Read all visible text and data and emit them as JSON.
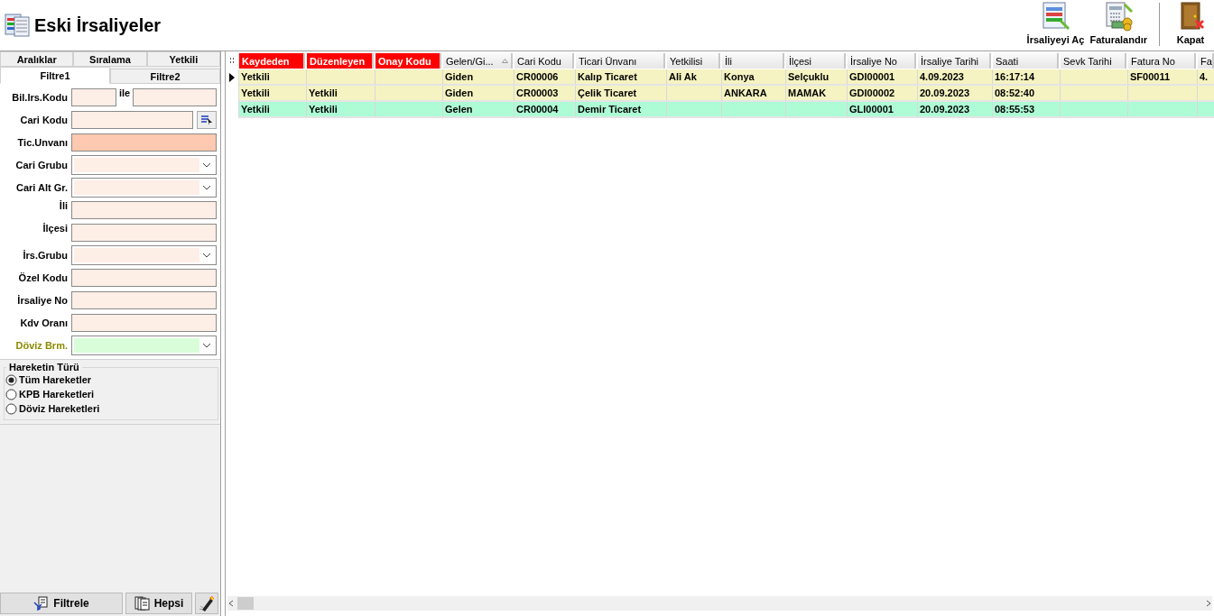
{
  "window": {
    "title": "Eski İrsaliyeler"
  },
  "toolbar": [
    {
      "label": "İrsaliyeyi Aç",
      "kind": "open"
    },
    {
      "label": "Faturalandır",
      "kind": "invoice"
    },
    {
      "label": "Kapat",
      "kind": "close"
    }
  ],
  "filter_tabs": {
    "top_row": [
      {
        "label": "Aralıklar",
        "selected": false
      },
      {
        "label": "Sıralama",
        "selected": false
      },
      {
        "label": "Yetkili",
        "selected": false
      }
    ],
    "bottom_row": [
      {
        "label": "Filtre1",
        "selected": true
      },
      {
        "label": "Filtre2",
        "selected": false
      }
    ]
  },
  "filters": [
    {
      "label": "Bil.Irs.Kodu",
      "kind": "range",
      "joiner": "ile",
      "color": "#fdeee6",
      "emphasized": false
    },
    {
      "label": "Cari Kodu",
      "kind": "lookup",
      "color": "#fdeee6",
      "emphasized": false
    },
    {
      "label": "Tic.Unvanı",
      "kind": "text",
      "color": "#fdc9b0",
      "emphasized": false
    },
    {
      "label": "Cari Grubu",
      "kind": "combo",
      "color": "#fdeee6",
      "emphasized": false
    },
    {
      "label": "Cari Alt Gr.",
      "kind": "combo",
      "color": "#fdeee6",
      "emphasized": false
    },
    {
      "label": "İli",
      "kind": "text",
      "color": "#fdeee6",
      "emphasized": false
    },
    {
      "label": "İlçesi",
      "kind": "text",
      "color": "#fdeee6",
      "emphasized": false
    },
    {
      "label": "İrs.Grubu",
      "kind": "combo",
      "color": "#fdeee6",
      "emphasized": false
    },
    {
      "label": "Özel Kodu",
      "kind": "text",
      "color": "#fdeee6",
      "emphasized": false
    },
    {
      "label": "İrsaliye No",
      "kind": "text",
      "color": "#fdeee6",
      "emphasized": false
    },
    {
      "label": "Kdv Oranı",
      "kind": "text",
      "color": "#fdeee6",
      "emphasized": false
    },
    {
      "label": "Döviz Brm.",
      "kind": "combo",
      "color": "#d8fdd8",
      "emphasized": true
    }
  ],
  "movement_type": {
    "title": "Hareketin Türü",
    "options": [
      {
        "label": "Tüm Hareketler",
        "selected": true
      },
      {
        "label": "KPB Hareketleri",
        "selected": false
      },
      {
        "label": "Döviz Hareketleri",
        "selected": false
      }
    ]
  },
  "filter_buttons": [
    {
      "label": "Filtrele",
      "kind": "filter"
    },
    {
      "label": "Hepsi",
      "kind": "all"
    },
    {
      "kind": "clear"
    }
  ],
  "table": {
    "columns": [
      {
        "label": "Kaydeden",
        "highlighted": true,
        "sorted": false
      },
      {
        "label": "Düzenleyen",
        "highlighted": true,
        "sorted": false
      },
      {
        "label": "Onay Kodu",
        "highlighted": true,
        "sorted": false
      },
      {
        "label": "Gelen/Gi...",
        "highlighted": false,
        "sorted": true
      },
      {
        "label": "Cari Kodu",
        "highlighted": false,
        "sorted": false
      },
      {
        "label": "Ticari Ünvanı",
        "highlighted": false,
        "sorted": false
      },
      {
        "label": "Yetkilisi",
        "highlighted": false,
        "sorted": false
      },
      {
        "label": "İli",
        "highlighted": false,
        "sorted": false
      },
      {
        "label": "İlçesi",
        "highlighted": false,
        "sorted": false
      },
      {
        "label": "İrsaliye No",
        "highlighted": false,
        "sorted": false
      },
      {
        "label": "İrsaliye Tarihi",
        "highlighted": false,
        "sorted": false
      },
      {
        "label": "Saati",
        "highlighted": false,
        "sorted": false
      },
      {
        "label": "Sevk Tarihi",
        "highlighted": false,
        "sorted": false
      },
      {
        "label": "Fatura No",
        "highlighted": false,
        "sorted": false
      },
      {
        "label": "Fa",
        "highlighted": false,
        "sorted": false
      }
    ],
    "rows": [
      {
        "selected": true,
        "color": "#f5f3c1",
        "cells": [
          "Yetkili",
          null,
          null,
          "Giden",
          "CR00006",
          "Kalıp Ticaret",
          "Ali Ak",
          "Konya",
          "Selçuklu",
          "GDI00001",
          "4.09.2023",
          "16:17:14",
          null,
          "SF00011",
          "4."
        ]
      },
      {
        "selected": false,
        "color": "#f5f3c1",
        "cells": [
          "Yetkili",
          "Yetkili",
          null,
          "Giden",
          "CR00003",
          "Çelik Ticaret",
          null,
          "ANKARA",
          "MAMAK",
          "GDI00002",
          "20.09.2023",
          "08:52:40",
          null,
          null,
          null
        ]
      },
      {
        "selected": false,
        "color": "#aefcd6",
        "cells": [
          "Yetkili",
          "Yetkili",
          null,
          "Gelen",
          "CR00004",
          "Demir Ticaret",
          null,
          null,
          null,
          "GLI00001",
          "20.09.2023",
          "08:55:53",
          null,
          null,
          null
        ]
      }
    ]
  }
}
